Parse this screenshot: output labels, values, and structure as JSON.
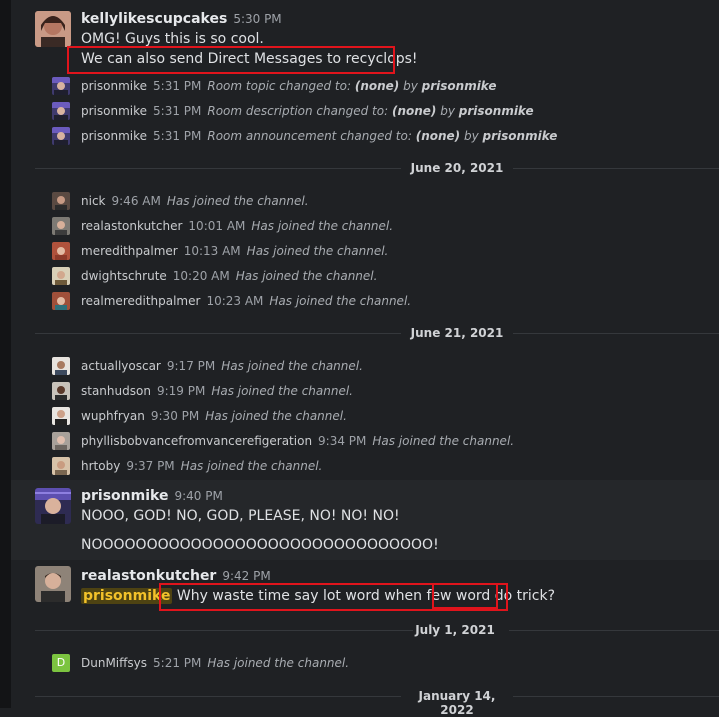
{
  "messages": {
    "kelly": {
      "user": "kellylikescupcakes",
      "time": "5:30 PM",
      "line1": "OMG! Guys this is so cool.",
      "line2": "We can also send Direct Messages to recyclops!"
    },
    "sys1": {
      "user": "prisonmike",
      "time": "5:31 PM",
      "pre": "Room topic changed to:",
      "val": "(none)",
      "by": "by",
      "who": "prisonmike"
    },
    "sys2": {
      "user": "prisonmike",
      "time": "5:31 PM",
      "pre": "Room description changed to:",
      "val": "(none)",
      "by": "by",
      "who": "prisonmike"
    },
    "sys3": {
      "user": "prisonmike",
      "time": "5:31 PM",
      "pre": "Room announcement changed to:",
      "val": "(none)",
      "by": "by",
      "who": "prisonmike"
    },
    "d1": {
      "label": "June 20, 2021"
    },
    "j1": {
      "user": "nick",
      "time": "9:46 AM",
      "act": "Has joined the channel."
    },
    "j2": {
      "user": "realastonkutcher",
      "time": "10:01 AM",
      "act": "Has joined the channel."
    },
    "j3": {
      "user": "meredithpalmer",
      "time": "10:13 AM",
      "act": "Has joined the channel."
    },
    "j4": {
      "user": "dwightschrute",
      "time": "10:20 AM",
      "act": "Has joined the channel."
    },
    "j5": {
      "user": "realmeredithpalmer",
      "time": "10:23 AM",
      "act": "Has joined the channel."
    },
    "d2": {
      "label": "June 21, 2021"
    },
    "k1": {
      "user": "actuallyoscar",
      "time": "9:17 PM",
      "act": "Has joined the channel."
    },
    "k2": {
      "user": "stanhudson",
      "time": "9:19 PM",
      "act": "Has joined the channel."
    },
    "k3": {
      "user": "wuphfryan",
      "time": "9:30 PM",
      "act": "Has joined the channel."
    },
    "k4": {
      "user": "phyllisbobvancefromvancerefigeration",
      "time": "9:34 PM",
      "act": "Has joined the channel."
    },
    "k5": {
      "user": "hrtoby",
      "time": "9:37 PM",
      "act": "Has joined the channel."
    },
    "mike": {
      "user": "prisonmike",
      "time": "9:40 PM",
      "line1": "NOOO, GOD! NO, GOD, PLEASE, NO! NO! NO!",
      "line2": "NOOOOOOOOOOOOOOOOOOOOOOOOOOOOOOO!"
    },
    "aston": {
      "user": "realastonkutcher",
      "time": "9:42 PM",
      "mention": "prisonmike",
      "text": "Why waste time say lot word when few word do trick?"
    },
    "d3": {
      "label": "July 1, 2021"
    },
    "dun": {
      "user": "DunMiffsys",
      "time": "5:21 PM",
      "act": "Has joined the channel.",
      "avatar_letter": "D"
    },
    "d4": {
      "label": "January 14, 2022"
    }
  },
  "colors": {
    "accent_red": "#e0141c",
    "mention_bg": "#4e4312",
    "mention_fg": "#f3c22a",
    "dun_avatar": "#7cc440"
  }
}
